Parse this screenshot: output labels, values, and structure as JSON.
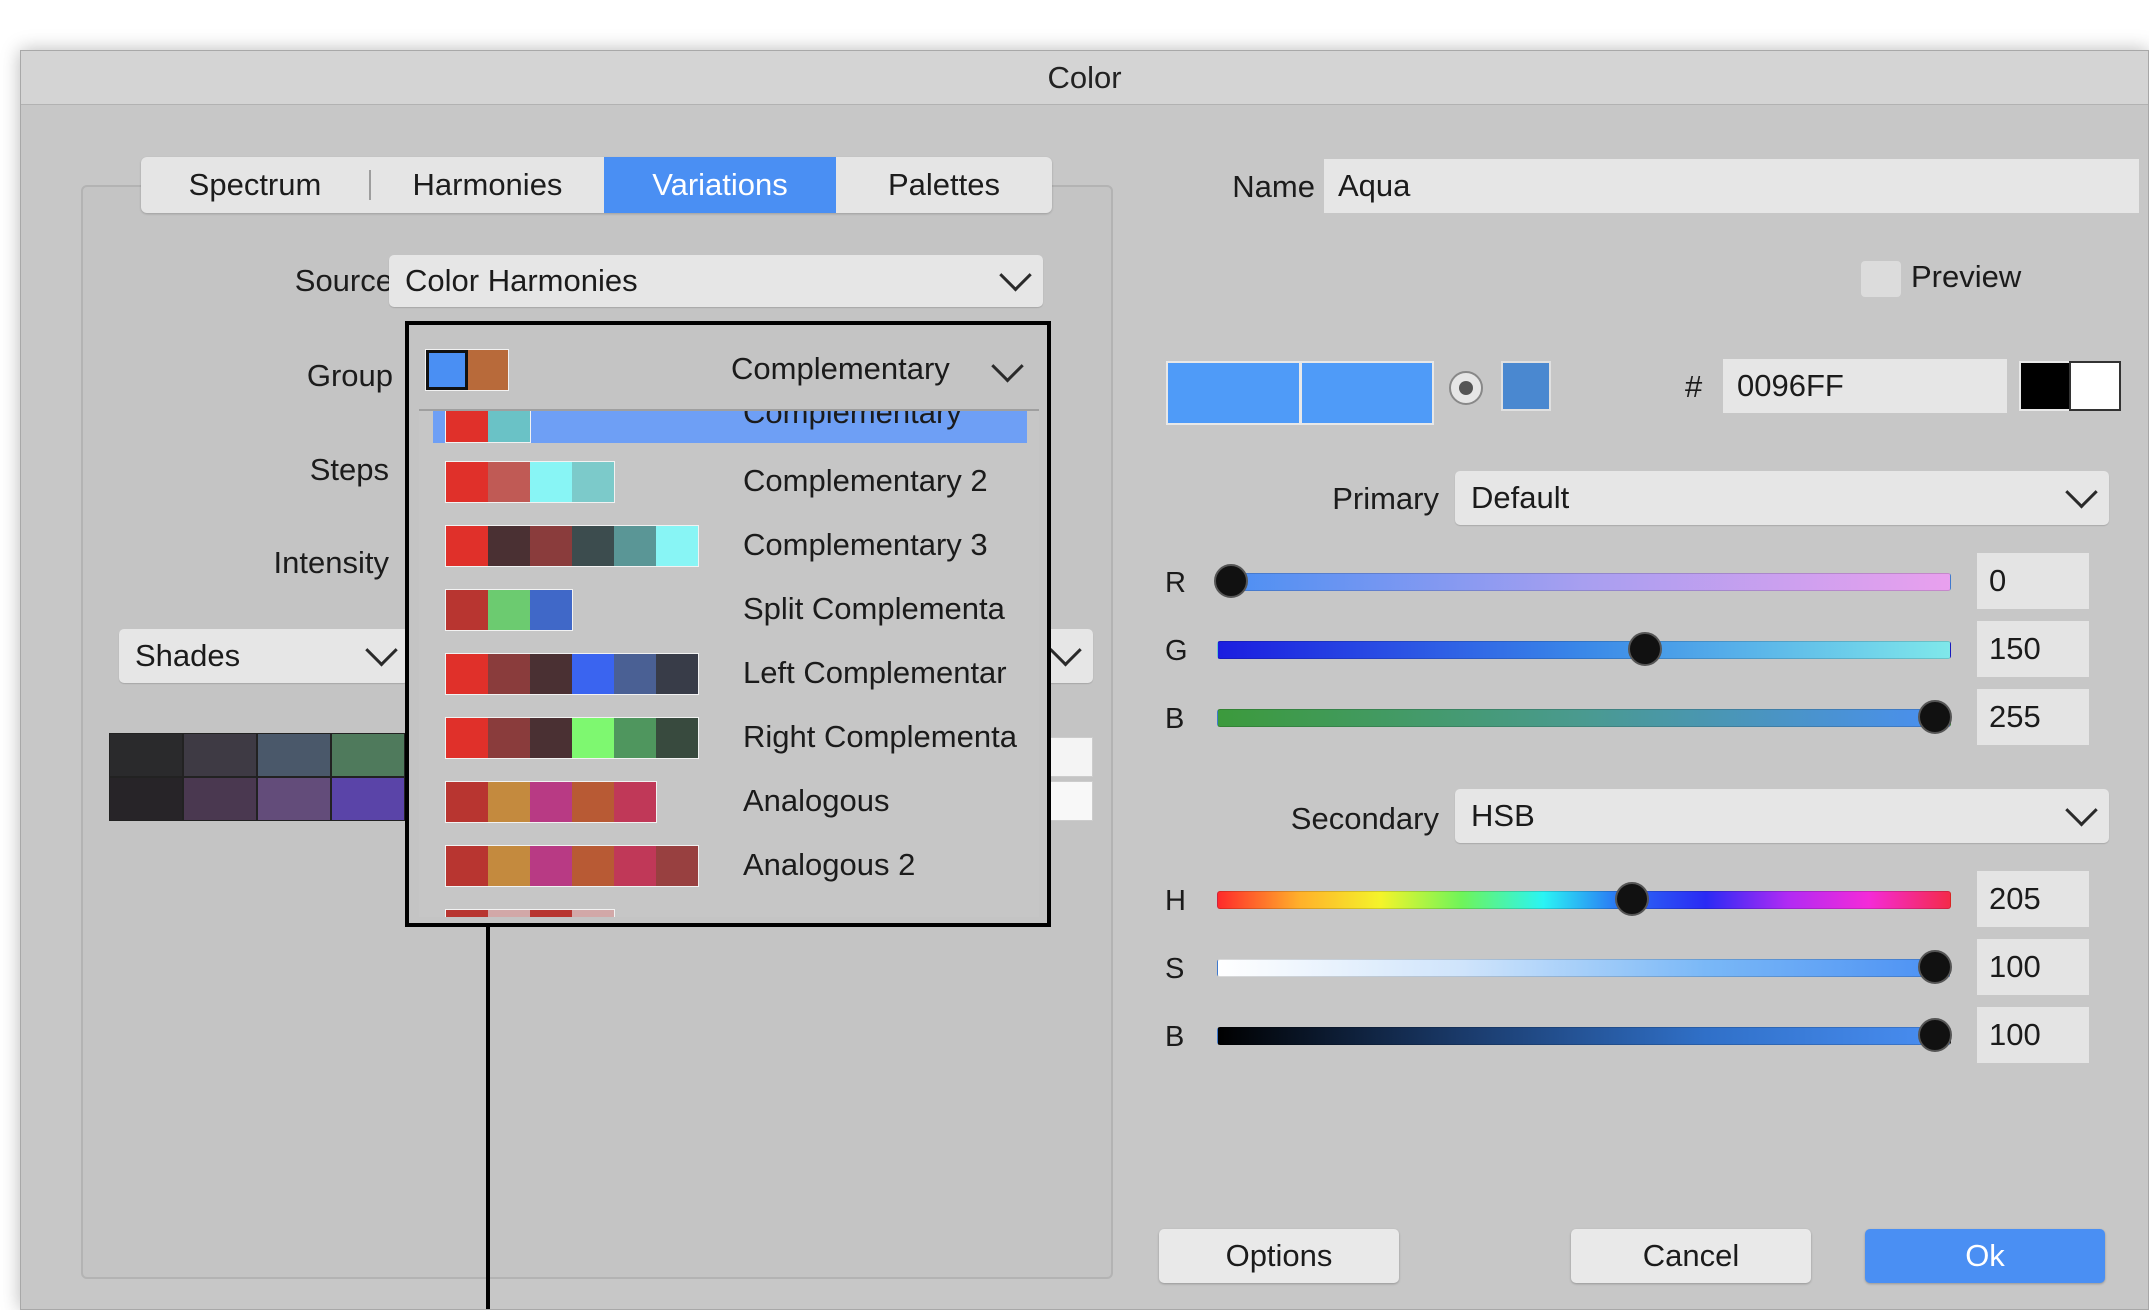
{
  "window": {
    "title": "Color"
  },
  "tabs": [
    {
      "label": "Spectrum"
    },
    {
      "label": "Harmonies"
    },
    {
      "label": "Variations"
    },
    {
      "label": "Palettes"
    }
  ],
  "left": {
    "source_label": "Source",
    "source_value": "Color Harmonies",
    "group_label": "Group",
    "group_value": "Complementary",
    "steps_label": "Steps",
    "intensity_label": "Intensity",
    "shades_value": "Shades",
    "preview_rows": [
      [
        "#2a2a2c",
        "#3e3a44",
        "#4a586a",
        "#4f7a5c"
      ],
      [
        "#272428",
        "#4a3850",
        "#634c7a",
        "#5a44a8"
      ]
    ]
  },
  "group_dropdown": {
    "items": [
      {
        "label": "Complementary",
        "swatches": [
          "#e0302a",
          "#6ac2c6"
        ],
        "selected": true
      },
      {
        "label": "Complementary 2",
        "swatches": [
          "#e0302a",
          "#c05a55",
          "#88f5f5",
          "#7ccaca"
        ]
      },
      {
        "label": "Complementary 3",
        "swatches": [
          "#e0302a",
          "#4a3033",
          "#8a3c3c",
          "#3c4c4e",
          "#5a9696",
          "#88f5f5"
        ]
      },
      {
        "label": "Split Complementa",
        "swatches": [
          "#b83530",
          "#6ccb70",
          "#4068c8"
        ]
      },
      {
        "label": "Left Complementar",
        "swatches": [
          "#e0302a",
          "#8a3c3c",
          "#4a3033",
          "#3a64f0",
          "#4a6094",
          "#383c48"
        ]
      },
      {
        "label": "Right Complementa",
        "swatches": [
          "#e0302a",
          "#8a3c3c",
          "#4a3033",
          "#7ef870",
          "#4f965e",
          "#384a3e"
        ]
      },
      {
        "label": "Analogous",
        "swatches": [
          "#b83530",
          "#c48a3e",
          "#b83a84",
          "#b85a34",
          "#c03858"
        ]
      },
      {
        "label": "Analogous 2",
        "swatches": [
          "#b83530",
          "#c48a3e",
          "#b83a84",
          "#b85a34",
          "#c03858",
          "#984040"
        ]
      },
      {
        "label": "",
        "swatches": [
          "#b83530",
          "#d2a8a8",
          "#b83530",
          "#d2a8a8"
        ]
      }
    ],
    "current_swatches": [
      "#4a8ff3",
      "#b86a3a"
    ]
  },
  "right": {
    "name_label": "Name",
    "name_value": "Aqua",
    "preview_label": "Preview",
    "hex_symbol": "#",
    "hex_value": "0096FF",
    "primary_label": "Primary",
    "primary_value": "Default",
    "secondary_label": "Secondary",
    "secondary_value": "HSB",
    "rgb": [
      {
        "label": "R",
        "value": "0",
        "fraction": 0.0
      },
      {
        "label": "G",
        "value": "150",
        "fraction": 0.588
      },
      {
        "label": "B",
        "value": "255",
        "fraction": 1.0
      }
    ],
    "hsb": [
      {
        "label": "H",
        "value": "205",
        "fraction": 0.569
      },
      {
        "label": "S",
        "value": "100",
        "fraction": 1.0
      },
      {
        "label": "B",
        "value": "100",
        "fraction": 1.0
      }
    ]
  },
  "buttons": {
    "options": "Options",
    "cancel": "Cancel",
    "ok": "Ok"
  },
  "colors": {
    "accent": "#4a8ff3",
    "current_color": "#4f9bf8",
    "web_safe_color": "#4a88d0"
  }
}
